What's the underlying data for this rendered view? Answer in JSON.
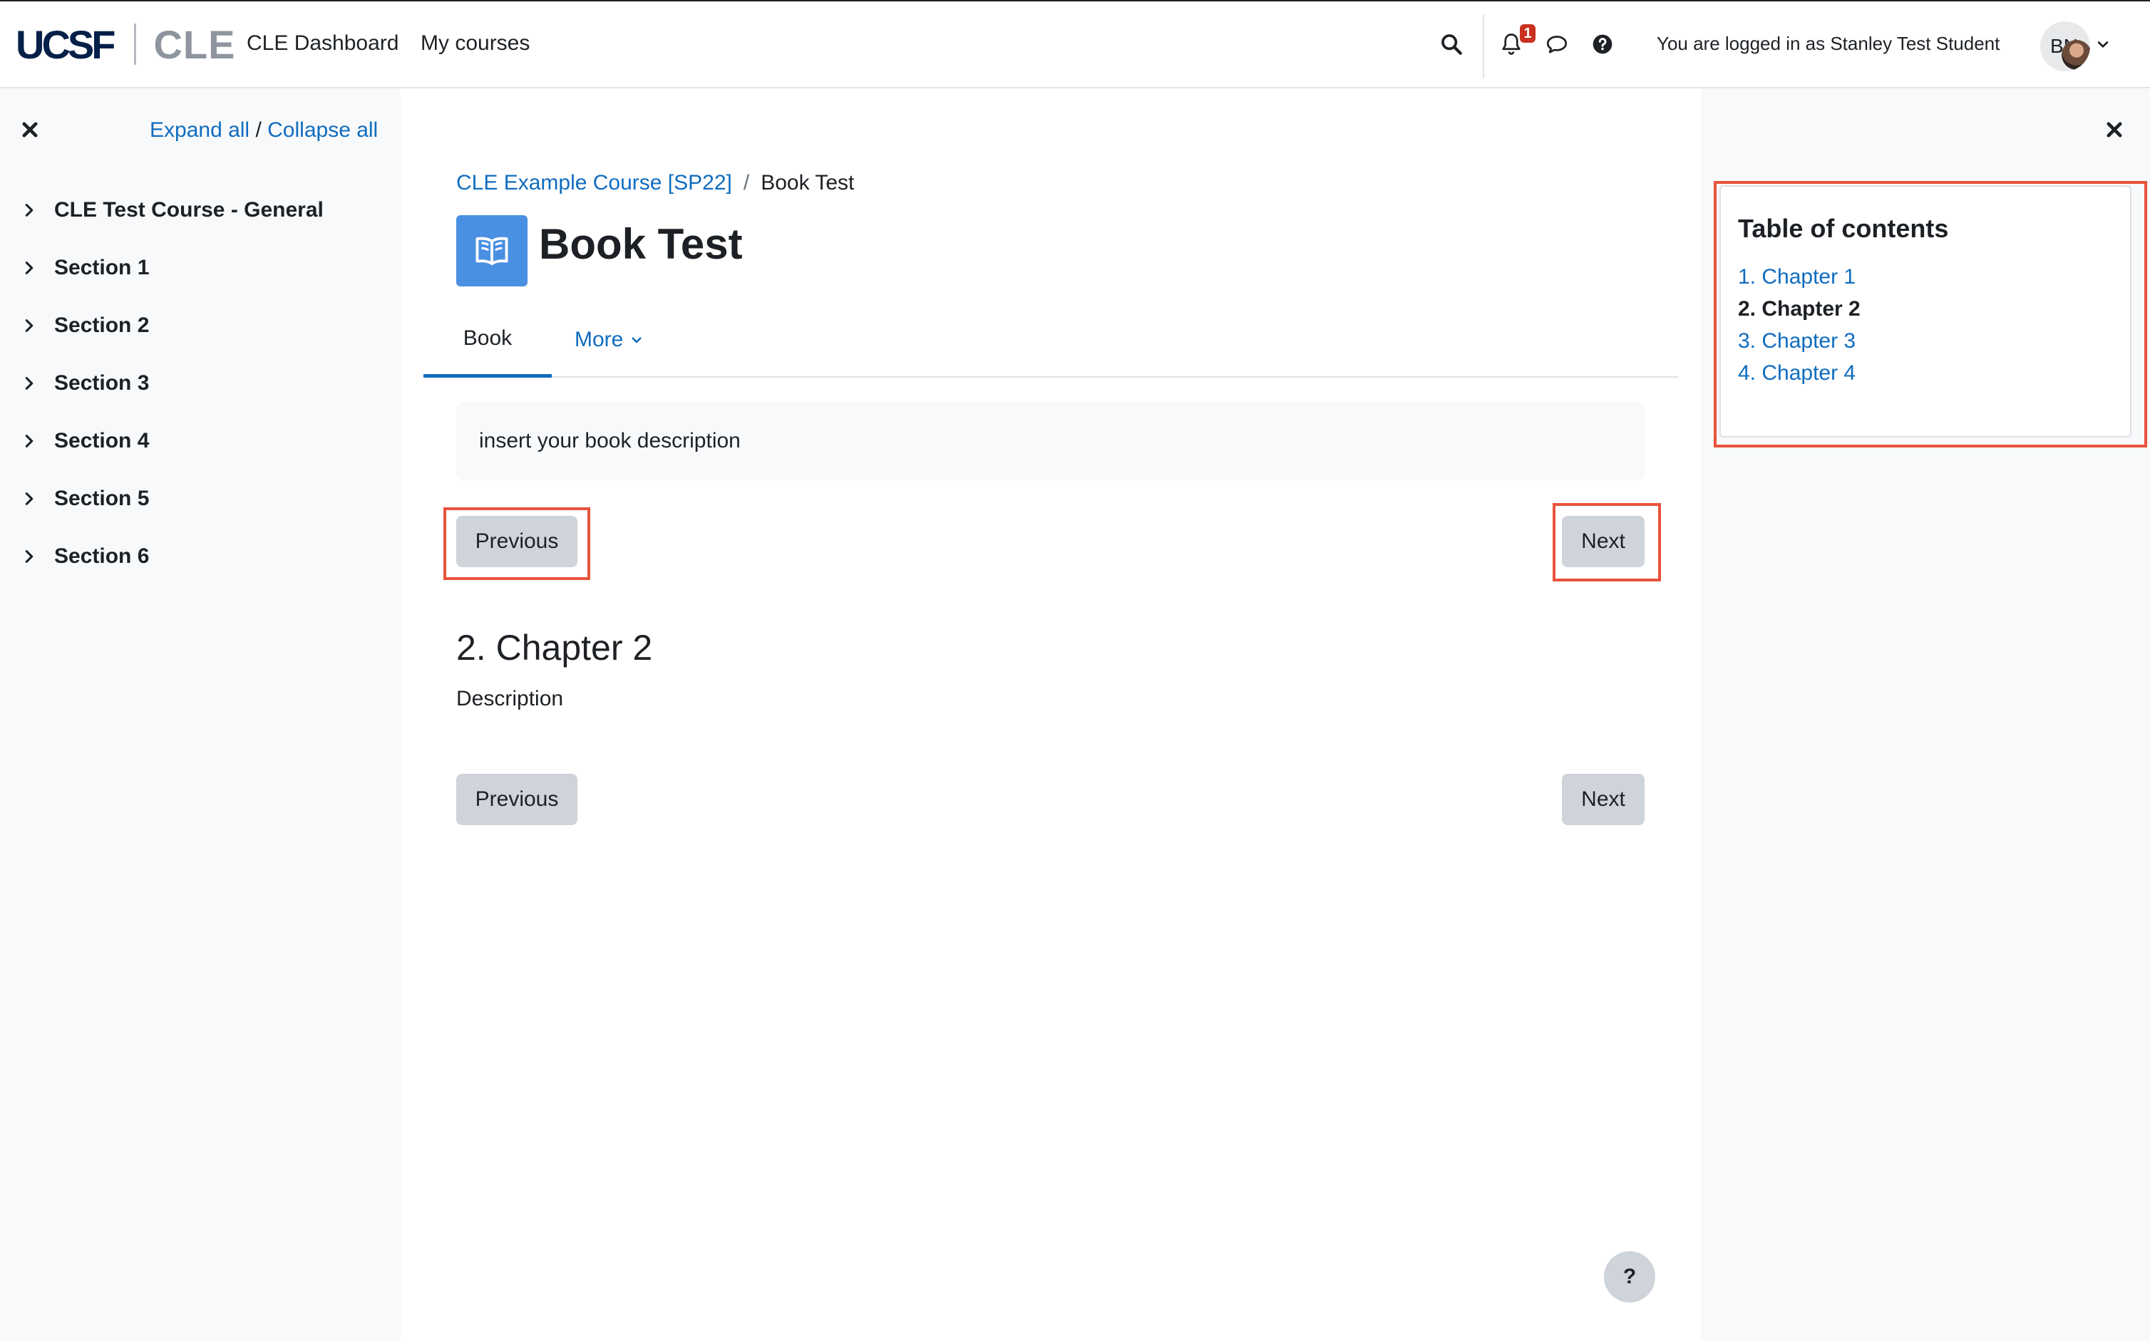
{
  "header": {
    "logo_primary": "UCSF",
    "logo_secondary": "CLE",
    "nav": [
      "CLE Dashboard",
      "My courses"
    ],
    "notification_count": "1",
    "login_text": "You are logged in as Stanley Test Student",
    "avatar_initials": "BN",
    "icons": [
      "search-icon",
      "bell-icon",
      "chat-icon",
      "help-icon",
      "chevron-down-icon"
    ]
  },
  "course_index": {
    "expand_all": "Expand all",
    "separator": "/",
    "collapse_all": "Collapse all",
    "sections": [
      "CLE Test Course - General",
      "Section 1",
      "Section 2",
      "Section 3",
      "Section 4",
      "Section 5",
      "Section 6"
    ]
  },
  "main": {
    "breadcrumb": {
      "course": "CLE Example Course [SP22]",
      "separator": "/",
      "current": "Book Test"
    },
    "title": "Book Test",
    "tabs": {
      "book": "Book",
      "more": "More"
    },
    "description": "insert your book description",
    "previous_label": "Previous",
    "next_label": "Next",
    "chapter_title": "2. Chapter 2",
    "chapter_description": "Description",
    "help_label": "?"
  },
  "toc": {
    "title": "Table of contents",
    "chapters": [
      "1. Chapter 1",
      "2. Chapter 2",
      "3. Chapter 3",
      "4. Chapter 4"
    ],
    "current_index": 1
  },
  "colors": {
    "link": "#0f6cbf",
    "highlight": "#e8533b",
    "badge": "#ca3120",
    "activity_icon": "#4a90e2"
  }
}
